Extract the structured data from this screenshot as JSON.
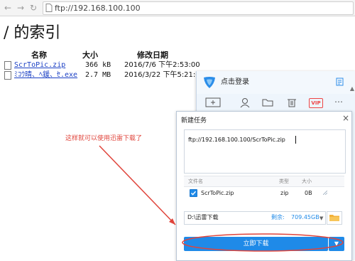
{
  "browser": {
    "url": "ftp://192.168.100.100",
    "back_icon": "arrow-left-icon",
    "forward_icon": "arrow-right-icon",
    "reload_icon": "reload-icon"
  },
  "listing": {
    "heading": "/ 的索引",
    "columns": {
      "name": "名称",
      "size": "大小",
      "modified": "修改日期"
    },
    "files": [
      {
        "name": "ScrToPic.zip",
        "size": "366 kB",
        "date": "2016/7/6 下午2:53:00"
      },
      {
        "name": "ﾐｺｳ晴、ﾍ鍰、ｾ.exe",
        "size": "2.7 MB",
        "date": "2016/3/22 下午5:21:00"
      }
    ]
  },
  "thunder": {
    "login_text": "点击登录",
    "accent_color": "#1f8ae8",
    "vip_label": "VIP",
    "toolbar_icons": [
      "new-task-icon",
      "user-icon",
      "folder-icon",
      "trash-icon",
      "vip-icon",
      "more-icon"
    ]
  },
  "dialog": {
    "title": "新建任务",
    "close_label": "×",
    "url_value": "ftp://192.168.100.100/ScrToPic.zip",
    "table_headers": {
      "filename": "文件名",
      "type": "类型",
      "size": "大小"
    },
    "file": {
      "name": "ScrToPic.zip",
      "type": "zip",
      "size": "0B",
      "checked": true
    },
    "save_path": "D:\\迅雷下载",
    "free_label": "剩余:",
    "free_value": "709.45GB",
    "download_label": "立即下载"
  },
  "annotation": {
    "text": "这样就可以使用迅雷下载了",
    "color": "#e0443b"
  }
}
